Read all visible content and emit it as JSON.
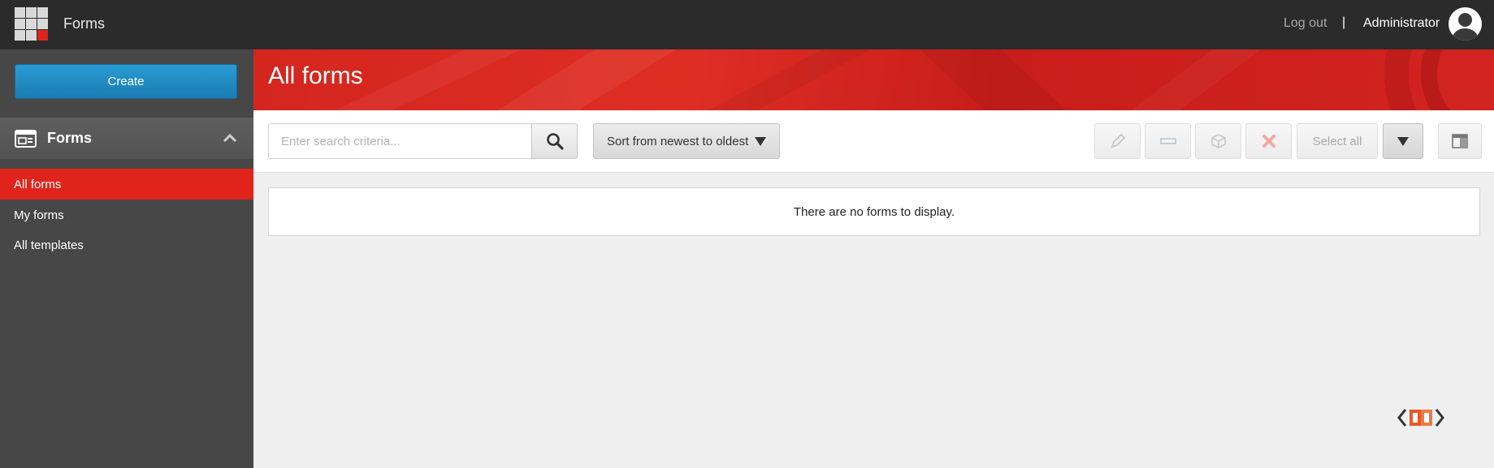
{
  "topbar": {
    "app_title": "Forms",
    "logout_label": "Log out",
    "separator": "|",
    "user_name": "Administrator"
  },
  "sidebar": {
    "create_label": "Create",
    "section_title": "Forms",
    "items": [
      {
        "label": "All forms",
        "active": true
      },
      {
        "label": "My forms",
        "active": false
      },
      {
        "label": "All templates",
        "active": false
      }
    ]
  },
  "banner": {
    "title": "All forms"
  },
  "toolbar": {
    "search_placeholder": "Enter search criteria...",
    "search_value": "",
    "sort_label": "Sort from newest to oldest",
    "select_all_label": "Select all"
  },
  "main": {
    "empty_message": "There are no forms to display."
  },
  "colors": {
    "topbar": "#2b2b2b",
    "sidebar": "#474747",
    "accent_red": "#e0241b",
    "create_blue": "#1f8cc4"
  }
}
